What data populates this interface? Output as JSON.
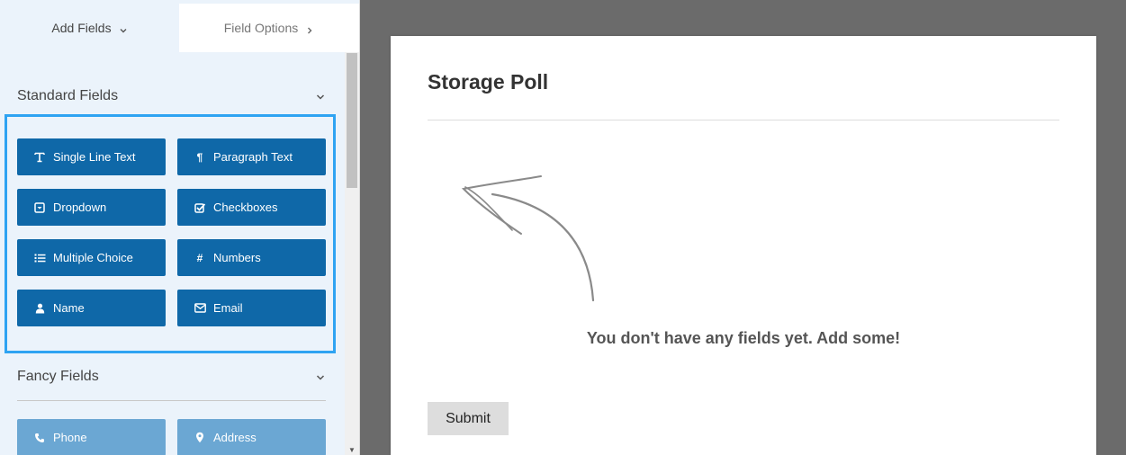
{
  "tabs": {
    "add_fields": "Add Fields",
    "field_options": "Field Options"
  },
  "sections": {
    "standard": "Standard Fields",
    "fancy": "Fancy Fields"
  },
  "standard_fields": [
    {
      "label": "Single Line Text",
      "icon": "text-icon"
    },
    {
      "label": "Paragraph Text",
      "icon": "paragraph-icon"
    },
    {
      "label": "Dropdown",
      "icon": "dropdown-icon"
    },
    {
      "label": "Checkboxes",
      "icon": "checkbox-icon"
    },
    {
      "label": "Multiple Choice",
      "icon": "list-icon"
    },
    {
      "label": "Numbers",
      "icon": "hash-icon"
    },
    {
      "label": "Name",
      "icon": "user-icon"
    },
    {
      "label": "Email",
      "icon": "envelope-icon"
    }
  ],
  "fancy_fields": [
    {
      "label": "Phone",
      "icon": "phone-icon"
    },
    {
      "label": "Address",
      "icon": "map-pin-icon"
    }
  ],
  "form": {
    "title": "Storage Poll",
    "empty_message": "You don't have any fields yet. Add some!",
    "submit_label": "Submit"
  },
  "colors": {
    "button": "#0f68a8",
    "button_faded": "#6ba7d3",
    "highlight": "#2ea3f2",
    "panel": "#ebf3fb",
    "backdrop": "#6b6b6b"
  }
}
